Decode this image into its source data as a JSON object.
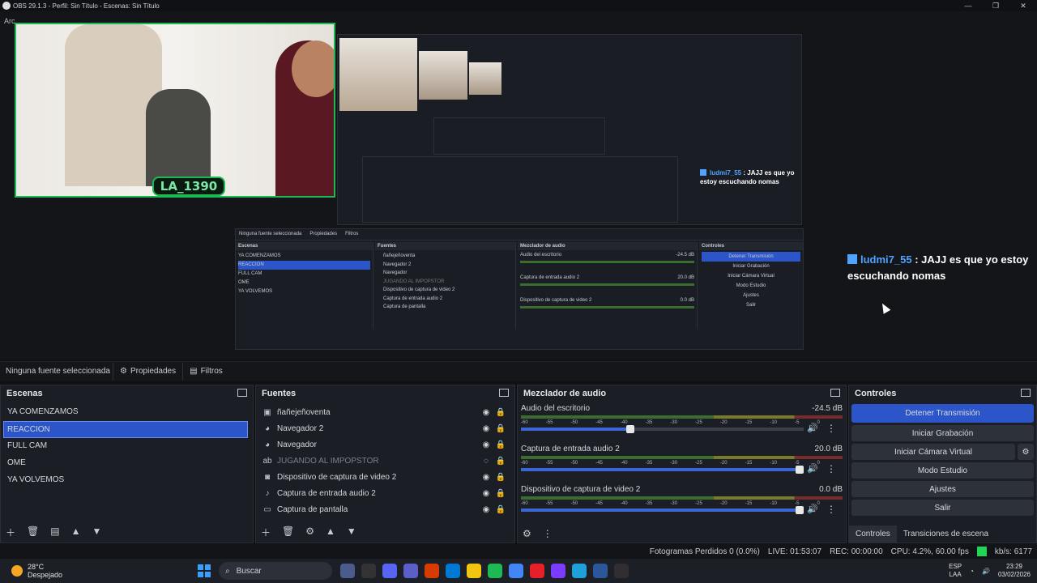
{
  "window": {
    "title": "OBS 29.1.3 - Perfil: Sin Título - Escenas: Sin Título",
    "menu_stub": "Arc",
    "controls": [
      "—",
      "❐",
      "✕"
    ]
  },
  "preview": {
    "cam_tag": "LA_1390",
    "chat": {
      "user": "ludmi7_55",
      "separator": " : ",
      "message": "JAJJ es que yo estoy escuchando nomas"
    },
    "mini_scene": {
      "nosel": "Ninguna fuente seleccionada",
      "props": "Propiedades",
      "filters": "Filtros",
      "scenes_title": "Escenas",
      "sources_title": "Fuentes",
      "mixer_title": "Mezclador de audio",
      "controls_title": "Controles",
      "scenes": [
        "YA COMENZAMOS",
        "REACCION",
        "FULL CAM",
        "OME",
        "YA VOLVEMOS"
      ],
      "sources": [
        "ñañejeñoventa",
        "Navegador 2",
        "Navegador",
        "JUGANDO AL IMPOPSTOR",
        "Dispositivo de captura de video 2",
        "Captura de entrada audio 2",
        "Captura de pantalla"
      ],
      "controls": [
        "Detener Transmisión",
        "Iniciar Grabación",
        "Iniciar Cámara Virtual",
        "Modo Estudio",
        "Ajustes",
        "Salir"
      ],
      "tracks": [
        {
          "name": "Audio del escritorio",
          "db": "-24.5 dB"
        },
        {
          "name": "Captura de entrada audio 2",
          "db": "20.0 dB"
        },
        {
          "name": "Dispositivo de captura de video 2",
          "db": "0.0 dB"
        }
      ]
    }
  },
  "source_bar": {
    "no_selection": "Ninguna fuente seleccionada",
    "properties": "Propiedades",
    "filters": "Filtros"
  },
  "scenes": {
    "title": "Escenas",
    "items": [
      "YA COMENZAMOS",
      "REACCION",
      "FULL CAM",
      "OME",
      "YA VOLVEMOS"
    ],
    "selected_index": 1
  },
  "sources": {
    "title": "Fuentes",
    "items": [
      {
        "icon": "image-icon",
        "glyph": "▣",
        "name": "ñañejeñoventa",
        "visible": true
      },
      {
        "icon": "browser-icon",
        "glyph": "◕",
        "name": "Navegador 2",
        "visible": true
      },
      {
        "icon": "browser-icon",
        "glyph": "◕",
        "name": "Navegador",
        "visible": true
      },
      {
        "icon": "text-icon",
        "glyph": "ab",
        "name": "JUGANDO AL IMPOPSTOR",
        "visible": false
      },
      {
        "icon": "camera-icon",
        "glyph": "◙",
        "name": "Dispositivo de captura de video 2",
        "visible": true
      },
      {
        "icon": "mic-icon",
        "glyph": "♪",
        "name": "Captura de entrada audio 2",
        "visible": true
      },
      {
        "icon": "monitor-icon",
        "glyph": "▭",
        "name": "Captura de pantalla",
        "visible": true
      }
    ]
  },
  "mixer": {
    "title": "Mezclador de audio",
    "ticks": [
      "-60",
      "-55",
      "-50",
      "-45",
      "-40",
      "-35",
      "-30",
      "-25",
      "-20",
      "-15",
      "-10",
      "-5",
      "0"
    ],
    "tracks": [
      {
        "name": "Audio del escritorio",
        "db": "-24.5 dB",
        "level": 0.4
      },
      {
        "name": "Captura de entrada audio 2",
        "db": "20.0 dB",
        "level": 1.0
      },
      {
        "name": "Dispositivo de captura de video 2",
        "db": "0.0 dB",
        "level": 1.0
      }
    ]
  },
  "controls": {
    "title": "Controles",
    "stop_stream": "Detener Transmisión",
    "start_recording": "Iniciar Grabación",
    "start_virtual_cam": "Iniciar Cámara Virtual",
    "studio_mode": "Modo Estudio",
    "settings": "Ajustes",
    "exit": "Salir",
    "tab_controls": "Controles",
    "tab_transitions": "Transiciones de escena"
  },
  "status": {
    "dropped": "Fotogramas Perdidos 0 (0.0%)",
    "live": "LIVE: 01:53:07",
    "rec": "REC: 00:00:00",
    "cpu": "CPU: 4.2%, 60.00 fps",
    "bitrate": "kb/s: 6177",
    "accent": "#1fd655"
  },
  "taskbar": {
    "temp": "28°C",
    "weather": "Despejado",
    "search": "Buscar",
    "lang": "ESP",
    "lang_sub": "LAA",
    "time": "23:29",
    "date": "03/02/2026"
  }
}
